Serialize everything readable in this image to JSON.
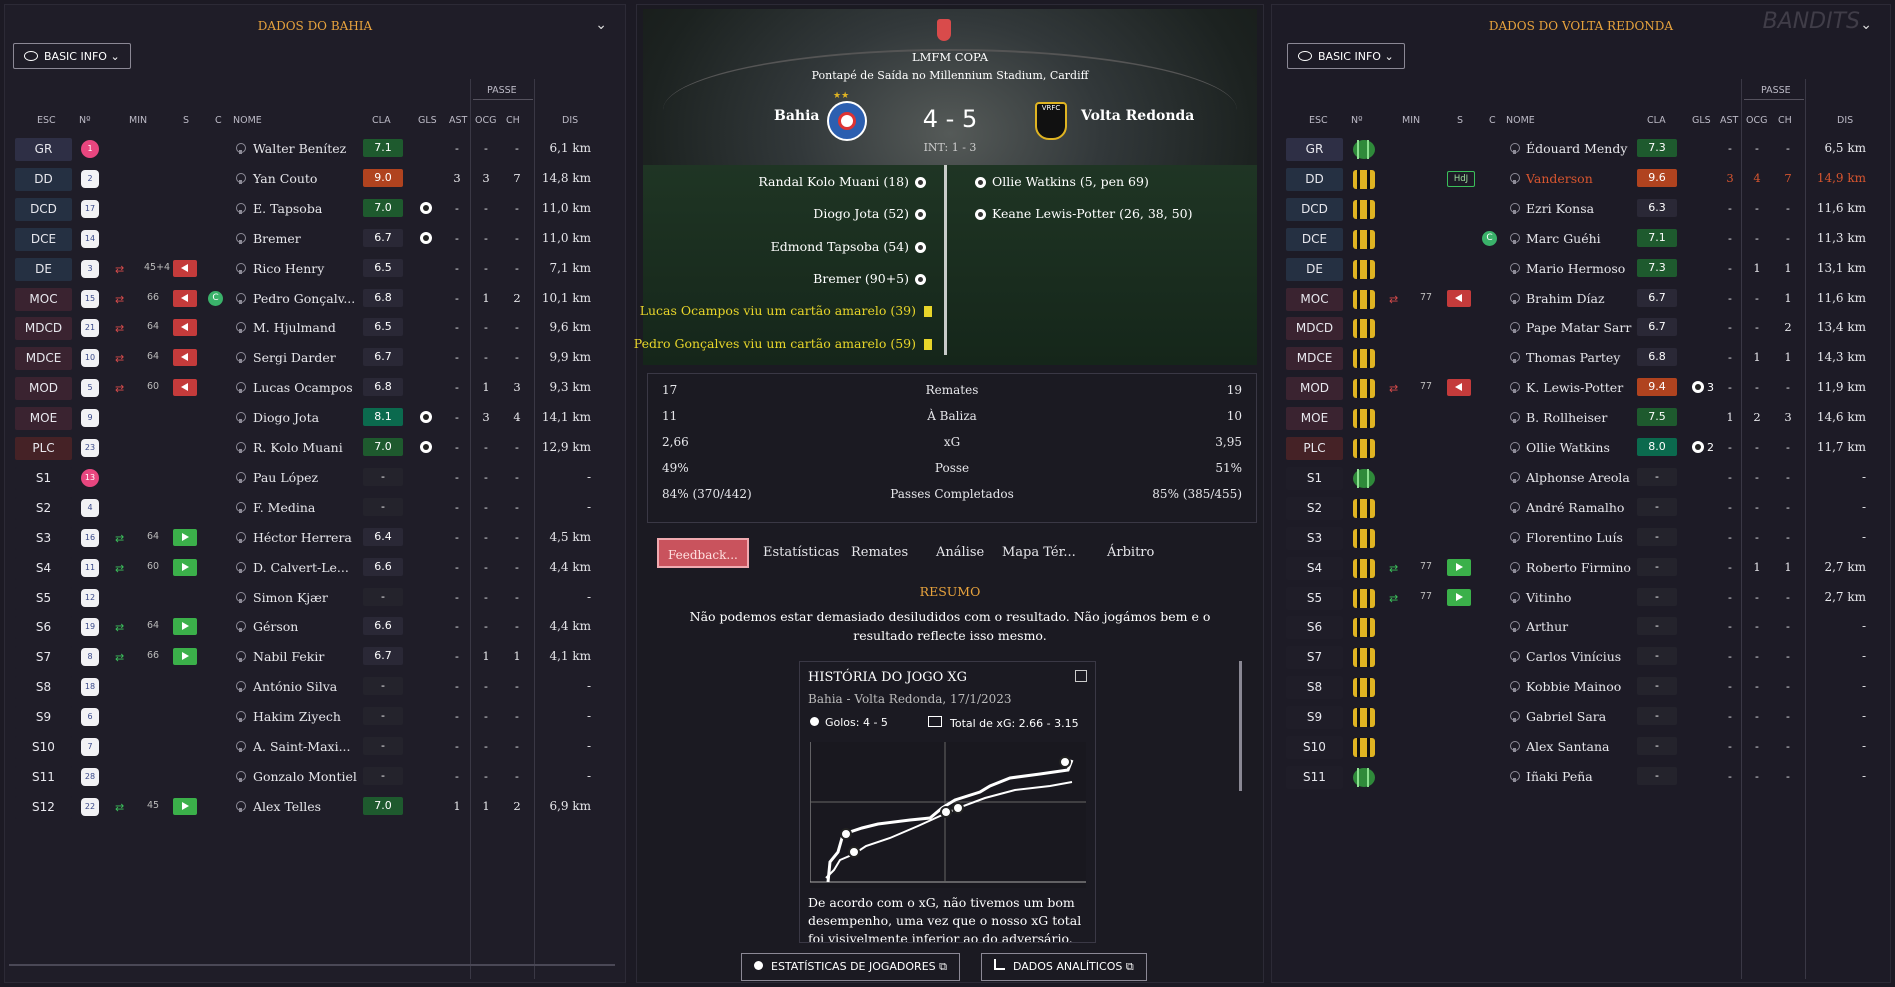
{
  "left": {
    "title": "DADOS DO BAHIA",
    "view_button": "BASIC INFO",
    "passe_label": "PASSE",
    "headers": {
      "esc": "ESC",
      "n": "Nº",
      "min": "MIN",
      "s": "S",
      "c": "C",
      "nome": "NOME",
      "cla": "CLA",
      "gls": "GLS",
      "ast": "AST",
      "ocg": "OCG",
      "ch": "CH",
      "dis": "DIS"
    },
    "players": [
      {
        "pos": "GR",
        "n": "1",
        "name": "Walter Benítez",
        "cla": "7.1",
        "gls": "",
        "ast": "-",
        "ocg": "-",
        "ch": "-",
        "dis": "6,1 km"
      },
      {
        "pos": "DD",
        "n": "2",
        "name": "Yan Couto",
        "cla": "9.0",
        "gls": "",
        "ast": "3",
        "ocg": "3",
        "ch": "7",
        "dis": "14,8 km"
      },
      {
        "pos": "DCD",
        "n": "17",
        "name": "E. Tapsoba",
        "cla": "7.0",
        "gls": "",
        "ast": "-",
        "ocg": "-",
        "ch": "-",
        "dis": "11,0 km"
      },
      {
        "pos": "DCE",
        "n": "14",
        "name": "Bremer",
        "cla": "6.7",
        "gls": "",
        "ast": "-",
        "ocg": "-",
        "ch": "-",
        "dis": "11,0 km"
      },
      {
        "pos": "DE",
        "n": "3",
        "name": "Rico Henry",
        "min": "45+4",
        "cla": "6.5",
        "gls": "",
        "ast": "-",
        "ocg": "-",
        "ch": "-",
        "dis": "7,1 km"
      },
      {
        "pos": "MOC",
        "n": "15",
        "name": "Pedro Gonçalv...",
        "min": "66",
        "cla": "6.8",
        "gls": "",
        "ast": "-",
        "ocg": "1",
        "ch": "2",
        "dis": "10,1 km"
      },
      {
        "pos": "MDCD",
        "n": "21",
        "name": "M. Hjulmand",
        "min": "64",
        "cla": "6.5",
        "gls": "",
        "ast": "-",
        "ocg": "-",
        "ch": "-",
        "dis": "9,6 km"
      },
      {
        "pos": "MDCE",
        "n": "10",
        "name": "Sergi Darder",
        "min": "64",
        "cla": "6.7",
        "gls": "",
        "ast": "-",
        "ocg": "-",
        "ch": "-",
        "dis": "9,9 km"
      },
      {
        "pos": "MOD",
        "n": "5",
        "name": "Lucas Ocampos",
        "min": "60",
        "cla": "6.8",
        "gls": "",
        "ast": "-",
        "ocg": "1",
        "ch": "3",
        "dis": "9,3 km"
      },
      {
        "pos": "MOE",
        "n": "9",
        "name": "Diogo Jota",
        "cla": "8.1",
        "gls": "",
        "ast": "-",
        "ocg": "3",
        "ch": "4",
        "dis": "14,1 km"
      },
      {
        "pos": "PLC",
        "n": "23",
        "name": "R. Kolo Muani",
        "cla": "7.0",
        "gls": "",
        "ast": "-",
        "ocg": "-",
        "ch": "-",
        "dis": "12,9 km"
      },
      {
        "pos": "S1",
        "n": "13",
        "name": "Pau López",
        "cla": "-",
        "gls": "",
        "ast": "-",
        "ocg": "-",
        "ch": "-",
        "dis": "-"
      },
      {
        "pos": "S2",
        "n": "4",
        "name": "F. Medina",
        "cla": "-",
        "gls": "",
        "ast": "-",
        "ocg": "-",
        "ch": "-",
        "dis": "-"
      },
      {
        "pos": "S3",
        "n": "16",
        "name": "Héctor Herrera",
        "min": "64",
        "cla": "6.4",
        "gls": "",
        "ast": "-",
        "ocg": "-",
        "ch": "-",
        "dis": "4,5 km"
      },
      {
        "pos": "S4",
        "n": "11",
        "name": "D. Calvert-Le...",
        "min": "60",
        "cla": "6.6",
        "gls": "",
        "ast": "-",
        "ocg": "-",
        "ch": "-",
        "dis": "4,4 km"
      },
      {
        "pos": "S5",
        "n": "12",
        "name": "Simon Kjær",
        "cla": "-",
        "gls": "",
        "ast": "-",
        "ocg": "-",
        "ch": "-",
        "dis": "-"
      },
      {
        "pos": "S6",
        "n": "19",
        "name": "Gérson",
        "min": "64",
        "cla": "6.6",
        "gls": "",
        "ast": "-",
        "ocg": "-",
        "ch": "-",
        "dis": "4,4 km"
      },
      {
        "pos": "S7",
        "n": "8",
        "name": "Nabil Fekir",
        "min": "66",
        "cla": "6.7",
        "gls": "",
        "ast": "-",
        "ocg": "1",
        "ch": "1",
        "dis": "4,1 km"
      },
      {
        "pos": "S8",
        "n": "18",
        "name": "António Silva",
        "cla": "-",
        "gls": "",
        "ast": "-",
        "ocg": "-",
        "ch": "-",
        "dis": "-"
      },
      {
        "pos": "S9",
        "n": "6",
        "name": "Hakim Ziyech",
        "cla": "-",
        "gls": "",
        "ast": "-",
        "ocg": "-",
        "ch": "-",
        "dis": "-"
      },
      {
        "pos": "S10",
        "n": "7",
        "name": "A. Saint-Maxi...",
        "cla": "-",
        "gls": "",
        "ast": "-",
        "ocg": "-",
        "ch": "-",
        "dis": "-"
      },
      {
        "pos": "S11",
        "n": "28",
        "name": "Gonzalo Montiel",
        "cla": "-",
        "gls": "",
        "ast": "-",
        "ocg": "-",
        "ch": "-",
        "dis": "-"
      },
      {
        "pos": "S12",
        "n": "22",
        "name": "Alex Telles",
        "min": "45",
        "cla": "7.0",
        "gls": "",
        "ast": "1",
        "ocg": "1",
        "ch": "2",
        "dis": "6,9 km"
      }
    ]
  },
  "right": {
    "title": "DADOS DO VOLTA REDONDA",
    "view_button": "BASIC INFO",
    "passe_label": "PASSE",
    "watermark": "BANDITS",
    "headers": {
      "esc": "ESC",
      "n": "Nº",
      "min": "MIN",
      "s": "S",
      "c": "C",
      "nome": "NOME",
      "cla": "CLA",
      "gls": "GLS",
      "ast": "AST",
      "ocg": "OCG",
      "ch": "CH",
      "dis": "DIS"
    },
    "players": [
      {
        "pos": "GR",
        "name": "Édouard Mendy",
        "cla": "7.3",
        "gls": "",
        "ast": "-",
        "ocg": "-",
        "ch": "-",
        "dis": "6,5 km"
      },
      {
        "pos": "DD",
        "name": "Vanderson",
        "tag": "HdJ",
        "cla": "9.6",
        "gls": "",
        "ast": "3",
        "ocg": "4",
        "ch": "7",
        "dis": "14,9 km"
      },
      {
        "pos": "DCD",
        "name": "Ezri Konsa",
        "cla": "6.3",
        "gls": "",
        "ast": "-",
        "ocg": "-",
        "ch": "-",
        "dis": "11,6 km"
      },
      {
        "pos": "DCE",
        "name": "Marc Guéhi",
        "cla": "7.1",
        "gls": "",
        "ast": "-",
        "ocg": "-",
        "ch": "-",
        "dis": "11,3 km"
      },
      {
        "pos": "DE",
        "name": "Mario Hermoso",
        "cla": "7.3",
        "gls": "",
        "ast": "-",
        "ocg": "1",
        "ch": "1",
        "dis": "13,1 km"
      },
      {
        "pos": "MOC",
        "name": "Brahim Díaz",
        "min": "77",
        "cla": "6.7",
        "gls": "",
        "ast": "-",
        "ocg": "-",
        "ch": "1",
        "dis": "11,6 km"
      },
      {
        "pos": "MDCD",
        "name": "Pape Matar Sarr",
        "cla": "6.7",
        "gls": "",
        "ast": "-",
        "ocg": "-",
        "ch": "2",
        "dis": "13,4 km"
      },
      {
        "pos": "MDCE",
        "name": "Thomas Partey",
        "cla": "6.8",
        "gls": "",
        "ast": "-",
        "ocg": "1",
        "ch": "1",
        "dis": "14,3 km"
      },
      {
        "pos": "MOD",
        "name": "K. Lewis-Potter",
        "min": "77",
        "cla": "9.4",
        "gls": "3",
        "ast": "-",
        "ocg": "-",
        "ch": "-",
        "dis": "11,9 km"
      },
      {
        "pos": "MOE",
        "name": "B. Rollheiser",
        "cla": "7.5",
        "gls": "",
        "ast": "1",
        "ocg": "2",
        "ch": "3",
        "dis": "14,6 km"
      },
      {
        "pos": "PLC",
        "name": "Ollie Watkins",
        "cla": "8.0",
        "gls": "2",
        "ast": "-",
        "ocg": "-",
        "ch": "-",
        "dis": "11,7 km"
      },
      {
        "pos": "S1",
        "name": "Alphonse Areola",
        "cla": "-",
        "gls": "",
        "ast": "-",
        "ocg": "-",
        "ch": "-",
        "dis": "-"
      },
      {
        "pos": "S2",
        "name": "André Ramalho",
        "cla": "-",
        "gls": "",
        "ast": "-",
        "ocg": "-",
        "ch": "-",
        "dis": "-"
      },
      {
        "pos": "S3",
        "name": "Florentino Luís",
        "cla": "-",
        "gls": "",
        "ast": "-",
        "ocg": "-",
        "ch": "-",
        "dis": "-"
      },
      {
        "pos": "S4",
        "name": "Roberto Firmino",
        "min": "77",
        "cla": "-",
        "gls": "",
        "ast": "-",
        "ocg": "1",
        "ch": "1",
        "dis": "2,7 km"
      },
      {
        "pos": "S5",
        "name": "Vitinho",
        "min": "77",
        "cla": "-",
        "gls": "",
        "ast": "-",
        "ocg": "-",
        "ch": "-",
        "dis": "2,7 km"
      },
      {
        "pos": "S6",
        "name": "Arthur",
        "cla": "-",
        "gls": "",
        "ast": "-",
        "ocg": "-",
        "ch": "-",
        "dis": "-"
      },
      {
        "pos": "S7",
        "name": "Carlos Vinícius",
        "cla": "-",
        "gls": "",
        "ast": "-",
        "ocg": "-",
        "ch": "-",
        "dis": "-"
      },
      {
        "pos": "S8",
        "name": "Kobbie Mainoo",
        "cla": "-",
        "gls": "",
        "ast": "-",
        "ocg": "-",
        "ch": "-",
        "dis": "-"
      },
      {
        "pos": "S9",
        "name": "Gabriel Sara",
        "cla": "-",
        "gls": "",
        "ast": "-",
        "ocg": "-",
        "ch": "-",
        "dis": "-"
      },
      {
        "pos": "S10",
        "name": "Alex Santana",
        "cla": "-",
        "gls": "",
        "ast": "-",
        "ocg": "-",
        "ch": "-",
        "dis": "-"
      },
      {
        "pos": "S11",
        "name": "Iñaki Peña",
        "cla": "-",
        "gls": "",
        "ast": "-",
        "ocg": "-",
        "ch": "-",
        "dis": "-"
      }
    ]
  },
  "match": {
    "competition": "LMFM COPA",
    "kickoff": "Pontapé de Saída no Millennium Stadium, Cardiff",
    "home": "Bahia",
    "away": "Volta Redonda",
    "away_crest": "VRFC",
    "score": "4 - 5",
    "halftime": "INT: 1 - 3",
    "home_events": [
      "Randal Kolo Muani (18)",
      "Diogo Jota (52)",
      "Edmond Tapsoba (54)",
      "Bremer (90+5)",
      "Lucas Ocampos viu um cartão amarelo (39)",
      "Pedro Gonçalves viu um cartão amarelo (59)"
    ],
    "away_events": [
      "Ollie Watkins (5, pen 69)",
      "Keane Lewis-Potter (26, 38, 50)"
    ]
  },
  "stats": [
    {
      "home": "17",
      "label": "Remates",
      "away": "19"
    },
    {
      "home": "11",
      "label": "À Baliza",
      "away": "10"
    },
    {
      "home": "2,66",
      "label": "xG",
      "away": "3,95"
    },
    {
      "home": "49%",
      "label": "Posse",
      "away": "51%"
    },
    {
      "home": "84% (370/442)",
      "label": "Passes Completados",
      "away": "85% (385/455)"
    }
  ],
  "tabs": [
    "Feedback...",
    "Estatísticas",
    "Remates",
    "Análise",
    "Mapa Tér...",
    "Árbitro"
  ],
  "summary": {
    "title": "RESUMO",
    "text": "Não podemos estar demasiado desiludidos com o resultado. Não jogámos bem e o resultado reflecte isso mesmo."
  },
  "xg_card": {
    "title": "HISTÓRIA DO JOGO XG",
    "subtitle": "Bahia - Volta Redonda, 17/1/2023",
    "goals": "Golos: 4 - 5",
    "total": "Total de xG: 2.66 - 3.15",
    "text": "De acordo com o xG, não tivemos um bom desempenho, uma vez que o nosso xG total foi visivelmente inferior ao do adversário."
  },
  "buttons": {
    "players_stats": "ESTATÍSTICAS DE JOGADORES",
    "analytics": "DADOS ANALÍTICOS"
  },
  "colors": {
    "accent": "#e8a33d",
    "highlight": "#d6552f",
    "good": "#1e5a2e",
    "yellow": "#e8d52a"
  }
}
